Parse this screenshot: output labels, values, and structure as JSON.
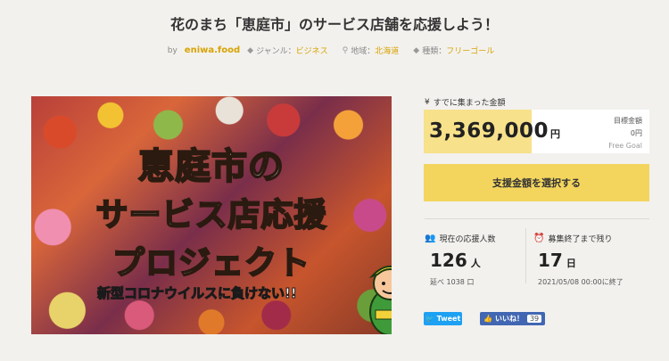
{
  "page": {
    "title": "花のまち「恵庭市」のサービス店舗を応援しよう！"
  },
  "meta": {
    "by_label": "by",
    "owner": "eniwa.food",
    "genre_label": "ジャンル：",
    "genre_value": "ビジネス",
    "region_label": "地域：",
    "region_value": "北海道",
    "type_label": "種類：",
    "type_value": "フリーゴール",
    "icons": [
      "tag-icon",
      "map-pin-icon",
      "tag-icon"
    ]
  },
  "hero": {
    "line1": "恵庭市の",
    "line2": "サービス店応援",
    "line3": "プロジェクト",
    "subtitle": "新型コロナウイルスに負けない!!"
  },
  "funding": {
    "label_icon": "yen-icon",
    "label": "すでに集まった金額",
    "amount": "3,369,000",
    "unit": "円",
    "goal_label": "目標金額",
    "goal_value": "0円",
    "goal_type": "Free Goal",
    "bar_fill_percent": 48,
    "accent_color": "#f7e18a"
  },
  "support_button": {
    "label": "支援金額を選択する",
    "color": "#f3d55e"
  },
  "stats": {
    "supporters_label": "現在の応援人数",
    "supporters_value": "126",
    "supporters_unit": "人",
    "supporters_sub": "延べ 1038 口",
    "remaining_label": "募集終了まで残り",
    "remaining_value": "17",
    "remaining_unit": "日",
    "remaining_sub": "2021/05/08 00:00に終了"
  },
  "social": {
    "tweet_label": "Tweet",
    "like_label": "いいね！",
    "like_count": "39",
    "tweet_color": "#1da1f2",
    "like_color": "#4267b2"
  }
}
